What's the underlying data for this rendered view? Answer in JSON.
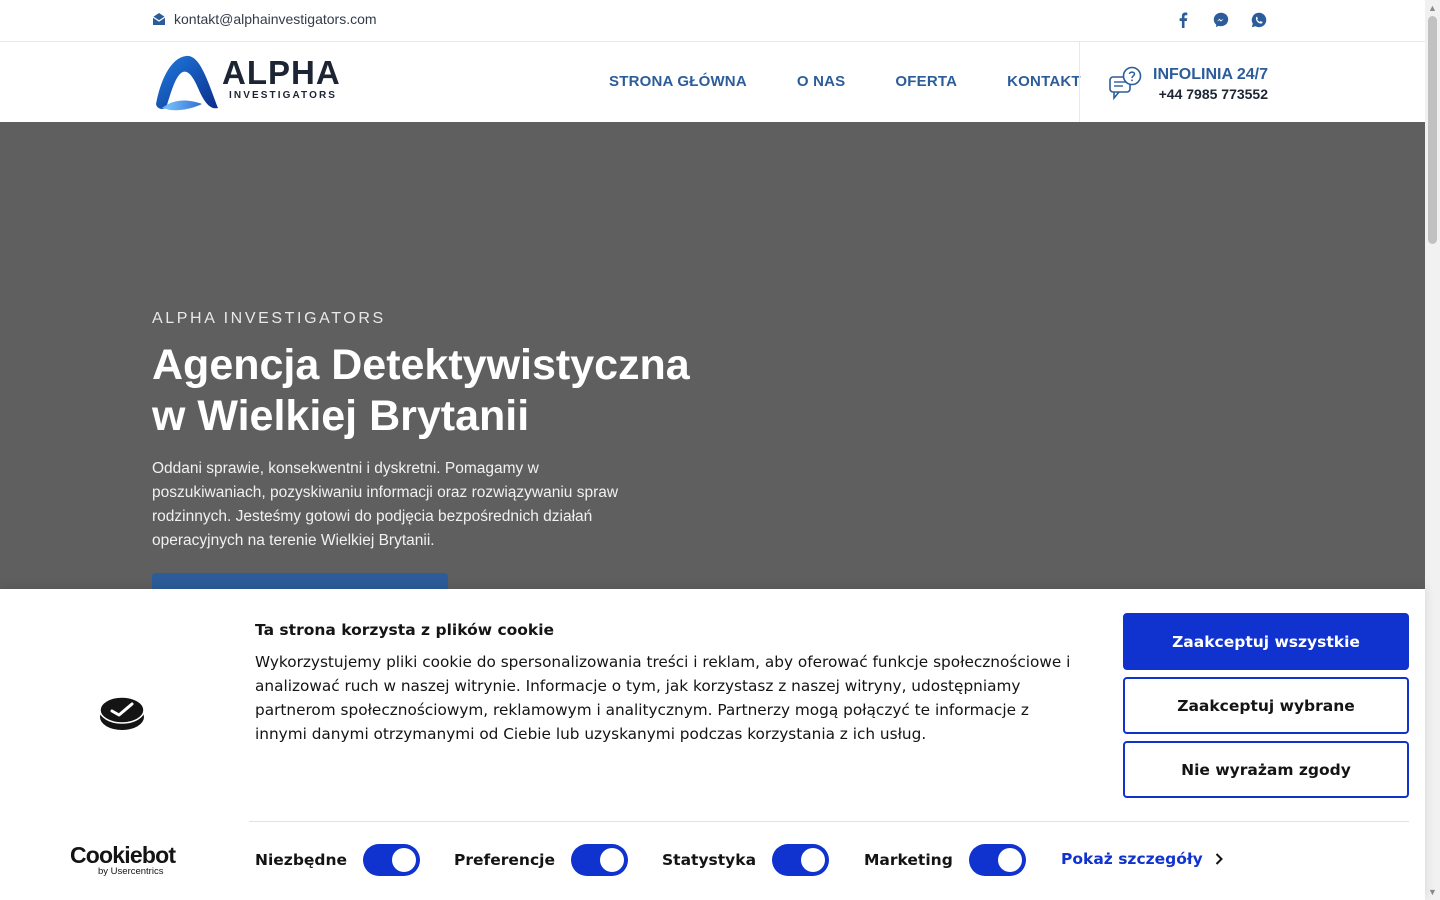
{
  "topbar": {
    "email": "kontakt@alphainvestigators.com",
    "socials": [
      "facebook-icon",
      "messenger-icon",
      "whatsapp-icon"
    ]
  },
  "header": {
    "logo": {
      "word1": "ALPHA",
      "word2": "INVESTIGATORS"
    },
    "nav": [
      {
        "label": "STRONA GŁÓWNA"
      },
      {
        "label": "O NAS"
      },
      {
        "label": "OFERTA"
      },
      {
        "label": "KONTAKT"
      }
    ],
    "infoline": {
      "title": "INFOLINIA 24/7",
      "phone": "+44 7985 773552"
    }
  },
  "hero": {
    "eyebrow": "ALPHA INVESTIGATORS",
    "title_line1": "Agencja Detektywistyczna",
    "title_line2": "w Wielkiej Brytanii",
    "description": "Oddani sprawie, konsekwentni i dyskretni. Pomagamy w poszukiwaniach, pozyskiwaniu informacji oraz rozwiązywaniu spraw rodzinnych. Jesteśmy gotowi do podjęcia bezpośrednich działań operacyjnych na terenie Wielkiej Brytanii."
  },
  "cookie_banner": {
    "brand": "Cookiebot",
    "brand_sub": "by Usercentrics",
    "title": "Ta strona korzysta z plików cookie",
    "text": "Wykorzystujemy pliki cookie do spersonalizowania treści i reklam, aby oferować funkcje społecznościowe i analizować ruch w naszej witrynie. Informacje o tym, jak korzystasz z naszej witryny, udostępniamy partnerom społecznościowym, reklamowym i analitycznym. Partnerzy mogą połączyć te informacje z innymi danymi otrzymanymi od Ciebie lub uzyskanymi podczas korzystania z ich usług.",
    "buttons": {
      "accept_all": "Zaakceptuj wszystkie",
      "accept_selected": "Zaakceptuj wybrane",
      "deny": "Nie wyrażam zgody"
    },
    "toggles": [
      {
        "label": "Niezbędne",
        "on": true
      },
      {
        "label": "Preferencje",
        "on": true
      },
      {
        "label": "Statystyka",
        "on": true
      },
      {
        "label": "Marketing",
        "on": true
      }
    ],
    "details_link": "Pokaż szczegóły"
  },
  "colors": {
    "brand_blue": "#2c5d9a",
    "cookie_blue": "#1032cf",
    "hero_bg": "#5f5f5f"
  }
}
